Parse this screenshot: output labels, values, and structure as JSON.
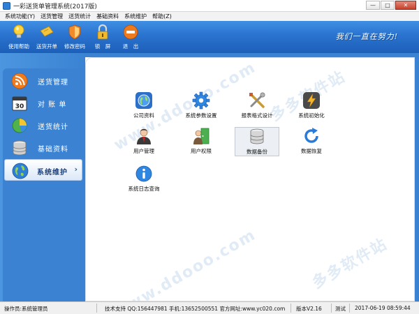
{
  "window": {
    "title": "一彩送货单管理系统(2017版)",
    "min_label": "—",
    "max_label": "□",
    "close_label": "✕"
  },
  "menu": [
    "系统功能(Y)",
    "送货管理",
    "送货统计",
    "基础资料",
    "系统维护",
    "帮助(Z)"
  ],
  "toolbar": {
    "items": [
      {
        "label": "使用帮助",
        "icon": "bulb-icon"
      },
      {
        "label": "送货开单",
        "icon": "ticket-icon"
      },
      {
        "label": "修改密码",
        "icon": "shield-icon"
      },
      {
        "label": "锁　屏",
        "icon": "lock-icon"
      },
      {
        "label": "退　出",
        "icon": "exit-icon"
      }
    ],
    "slogan": "我们一直在努力!"
  },
  "sidebar": {
    "items": [
      {
        "label": "送货管理",
        "icon": "rss-icon",
        "active": false
      },
      {
        "label": "对 账 单",
        "icon": "calendar-icon",
        "active": false
      },
      {
        "label": "送货统计",
        "icon": "pie-chart-icon",
        "active": false
      },
      {
        "label": "基础资料",
        "icon": "database-icon",
        "active": false
      },
      {
        "label": "系统维护",
        "icon": "globe-icon",
        "active": true
      }
    ],
    "chevron": "›"
  },
  "tiles": [
    {
      "label": "公司资料",
      "icon": "globe-icon"
    },
    {
      "label": "系统参数设置",
      "icon": "gear-icon"
    },
    {
      "label": "报表格式设计",
      "icon": "tools-icon"
    },
    {
      "label": "系统初始化",
      "icon": "lightning-icon"
    },
    {
      "label": "用户管理",
      "icon": "user-icon"
    },
    {
      "label": "用户权限",
      "icon": "user-door-icon"
    },
    {
      "label": "数据备份",
      "icon": "database-icon"
    },
    {
      "label": "数据恢复",
      "icon": "refresh-icon"
    },
    {
      "label": "系统日志查询",
      "icon": "info-icon"
    }
  ],
  "status": {
    "operator": "操作员:系统管理员",
    "support": "技术支持 QQ:156447981 手机:13652500551 官方网址:www.yc020.com",
    "version": "版本V2.16",
    "mode": "测试",
    "datetime": "2017-06-19 08:59:44"
  },
  "colors": {
    "toolbar_top": "#3f8fe4",
    "toolbar_bottom": "#1c5fb8",
    "sidebar": "#3b83d2"
  }
}
